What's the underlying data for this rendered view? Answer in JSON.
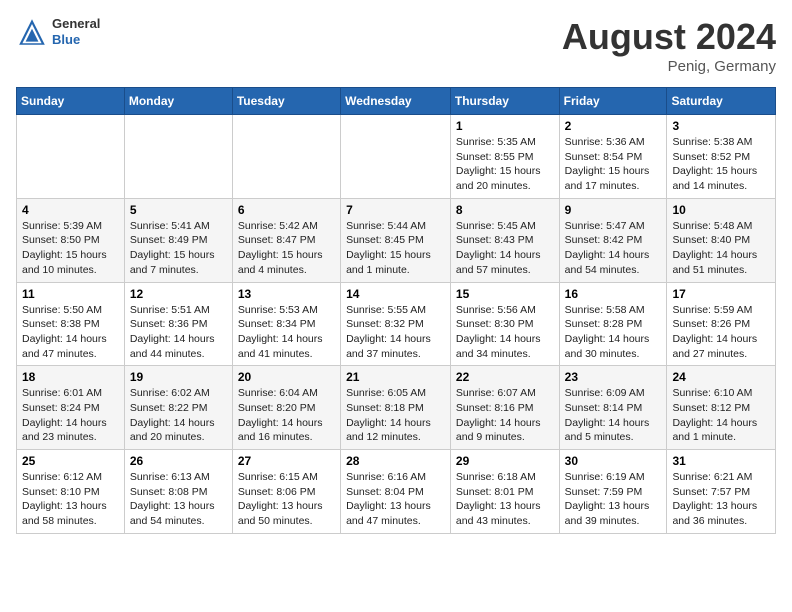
{
  "header": {
    "logo": {
      "general": "General",
      "blue": "Blue"
    },
    "month": "August 2024",
    "location": "Penig, Germany"
  },
  "days_of_week": [
    "Sunday",
    "Monday",
    "Tuesday",
    "Wednesday",
    "Thursday",
    "Friday",
    "Saturday"
  ],
  "weeks": [
    [
      {
        "day": "",
        "info": ""
      },
      {
        "day": "",
        "info": ""
      },
      {
        "day": "",
        "info": ""
      },
      {
        "day": "",
        "info": ""
      },
      {
        "day": "1",
        "info": "Sunrise: 5:35 AM\nSunset: 8:55 PM\nDaylight: 15 hours and 20 minutes."
      },
      {
        "day": "2",
        "info": "Sunrise: 5:36 AM\nSunset: 8:54 PM\nDaylight: 15 hours and 17 minutes."
      },
      {
        "day": "3",
        "info": "Sunrise: 5:38 AM\nSunset: 8:52 PM\nDaylight: 15 hours and 14 minutes."
      }
    ],
    [
      {
        "day": "4",
        "info": "Sunrise: 5:39 AM\nSunset: 8:50 PM\nDaylight: 15 hours and 10 minutes."
      },
      {
        "day": "5",
        "info": "Sunrise: 5:41 AM\nSunset: 8:49 PM\nDaylight: 15 hours and 7 minutes."
      },
      {
        "day": "6",
        "info": "Sunrise: 5:42 AM\nSunset: 8:47 PM\nDaylight: 15 hours and 4 minutes."
      },
      {
        "day": "7",
        "info": "Sunrise: 5:44 AM\nSunset: 8:45 PM\nDaylight: 15 hours and 1 minute."
      },
      {
        "day": "8",
        "info": "Sunrise: 5:45 AM\nSunset: 8:43 PM\nDaylight: 14 hours and 57 minutes."
      },
      {
        "day": "9",
        "info": "Sunrise: 5:47 AM\nSunset: 8:42 PM\nDaylight: 14 hours and 54 minutes."
      },
      {
        "day": "10",
        "info": "Sunrise: 5:48 AM\nSunset: 8:40 PM\nDaylight: 14 hours and 51 minutes."
      }
    ],
    [
      {
        "day": "11",
        "info": "Sunrise: 5:50 AM\nSunset: 8:38 PM\nDaylight: 14 hours and 47 minutes."
      },
      {
        "day": "12",
        "info": "Sunrise: 5:51 AM\nSunset: 8:36 PM\nDaylight: 14 hours and 44 minutes."
      },
      {
        "day": "13",
        "info": "Sunrise: 5:53 AM\nSunset: 8:34 PM\nDaylight: 14 hours and 41 minutes."
      },
      {
        "day": "14",
        "info": "Sunrise: 5:55 AM\nSunset: 8:32 PM\nDaylight: 14 hours and 37 minutes."
      },
      {
        "day": "15",
        "info": "Sunrise: 5:56 AM\nSunset: 8:30 PM\nDaylight: 14 hours and 34 minutes."
      },
      {
        "day": "16",
        "info": "Sunrise: 5:58 AM\nSunset: 8:28 PM\nDaylight: 14 hours and 30 minutes."
      },
      {
        "day": "17",
        "info": "Sunrise: 5:59 AM\nSunset: 8:26 PM\nDaylight: 14 hours and 27 minutes."
      }
    ],
    [
      {
        "day": "18",
        "info": "Sunrise: 6:01 AM\nSunset: 8:24 PM\nDaylight: 14 hours and 23 minutes."
      },
      {
        "day": "19",
        "info": "Sunrise: 6:02 AM\nSunset: 8:22 PM\nDaylight: 14 hours and 20 minutes."
      },
      {
        "day": "20",
        "info": "Sunrise: 6:04 AM\nSunset: 8:20 PM\nDaylight: 14 hours and 16 minutes."
      },
      {
        "day": "21",
        "info": "Sunrise: 6:05 AM\nSunset: 8:18 PM\nDaylight: 14 hours and 12 minutes."
      },
      {
        "day": "22",
        "info": "Sunrise: 6:07 AM\nSunset: 8:16 PM\nDaylight: 14 hours and 9 minutes."
      },
      {
        "day": "23",
        "info": "Sunrise: 6:09 AM\nSunset: 8:14 PM\nDaylight: 14 hours and 5 minutes."
      },
      {
        "day": "24",
        "info": "Sunrise: 6:10 AM\nSunset: 8:12 PM\nDaylight: 14 hours and 1 minute."
      }
    ],
    [
      {
        "day": "25",
        "info": "Sunrise: 6:12 AM\nSunset: 8:10 PM\nDaylight: 13 hours and 58 minutes."
      },
      {
        "day": "26",
        "info": "Sunrise: 6:13 AM\nSunset: 8:08 PM\nDaylight: 13 hours and 54 minutes."
      },
      {
        "day": "27",
        "info": "Sunrise: 6:15 AM\nSunset: 8:06 PM\nDaylight: 13 hours and 50 minutes."
      },
      {
        "day": "28",
        "info": "Sunrise: 6:16 AM\nSunset: 8:04 PM\nDaylight: 13 hours and 47 minutes."
      },
      {
        "day": "29",
        "info": "Sunrise: 6:18 AM\nSunset: 8:01 PM\nDaylight: 13 hours and 43 minutes."
      },
      {
        "day": "30",
        "info": "Sunrise: 6:19 AM\nSunset: 7:59 PM\nDaylight: 13 hours and 39 minutes."
      },
      {
        "day": "31",
        "info": "Sunrise: 6:21 AM\nSunset: 7:57 PM\nDaylight: 13 hours and 36 minutes."
      }
    ]
  ]
}
